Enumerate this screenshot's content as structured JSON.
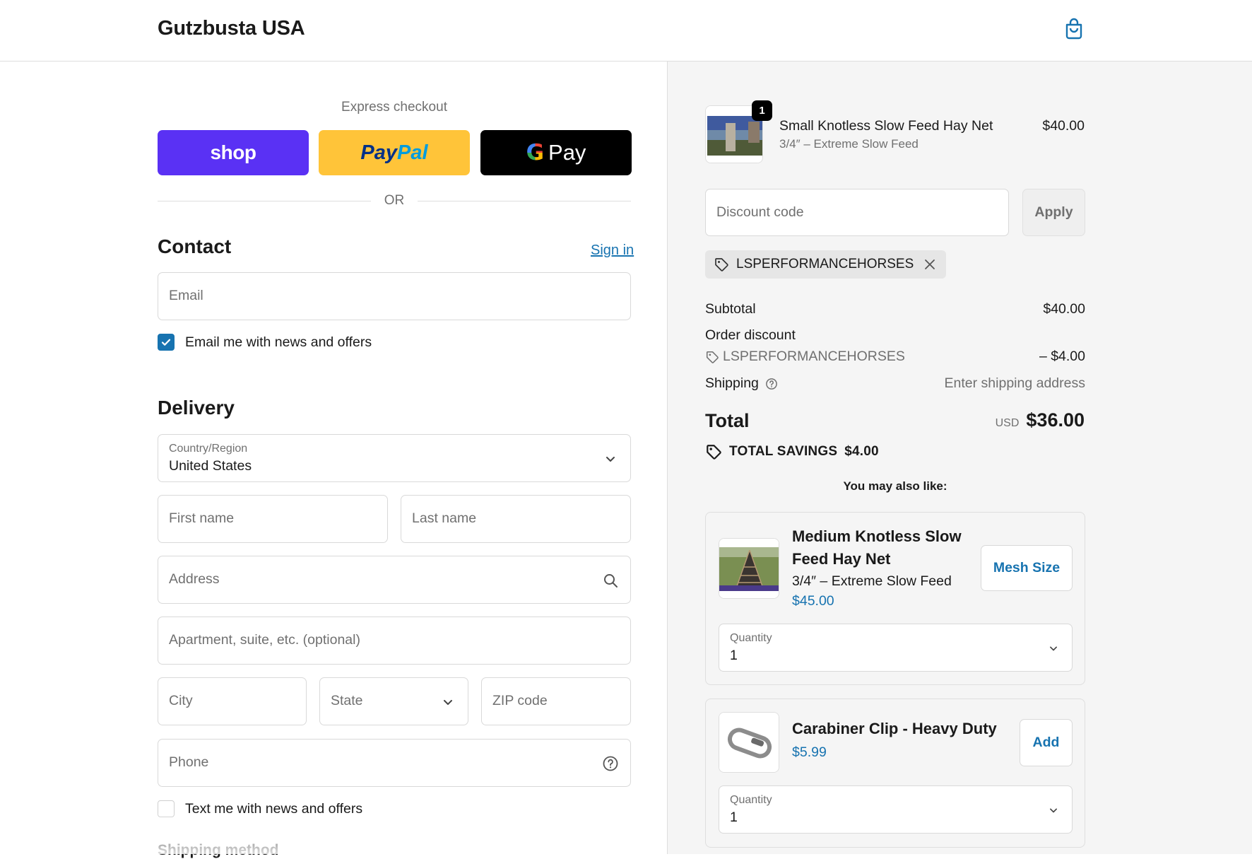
{
  "header": {
    "store_name": "Gutzbusta USA",
    "cart_icon": "shopping-bag-icon"
  },
  "express": {
    "label": "Express checkout",
    "buttons": [
      {
        "label": "shop",
        "color": "#5a31f4"
      },
      {
        "label_a": "Pay",
        "label_b": "Pal",
        "color": "#ffc439"
      },
      {
        "label_g": "G",
        "label": "Pay",
        "color": "#000000"
      }
    ],
    "or_text": "OR"
  },
  "contact": {
    "title": "Contact",
    "sign_in": "Sign in",
    "email_placeholder": "Email",
    "news_label": "Email me with news and offers",
    "news_checked": true
  },
  "delivery": {
    "title": "Delivery",
    "country_label": "Country/Region",
    "country_value": "United States",
    "first_name": "First name",
    "last_name": "Last name",
    "address": "Address",
    "apartment": "Apartment, suite, etc. (optional)",
    "city": "City",
    "state": "State",
    "zip": "ZIP code",
    "phone": "Phone",
    "text_label": "Text me with news and offers",
    "text_checked": false
  },
  "shipping_method_title": "Shipping method",
  "order": {
    "item": {
      "quantity": "1",
      "name": "Small Knotless Slow Feed Hay Net",
      "variant": "3/4″ – Extreme Slow Feed",
      "price": "$40.00"
    },
    "discount_placeholder": "Discount code",
    "apply_label": "Apply",
    "applied_code": "LSPERFORMANCEHORSES",
    "subtotal_label": "Subtotal",
    "subtotal_value": "$40.00",
    "order_discount_label": "Order discount",
    "discount_code": "LSPERFORMANCEHORSES",
    "discount_value": "– $4.00",
    "shipping_label": "Shipping",
    "shipping_value": "Enter shipping address",
    "total_label": "Total",
    "currency": "USD",
    "total_value": "$36.00",
    "savings_label": "TOTAL SAVINGS",
    "savings_value": "$4.00"
  },
  "recommendations": {
    "title": "You may also like:",
    "items": [
      {
        "name_line1": "Medium Knotless Slow",
        "name_line2": "Feed Hay Net",
        "variant": "3/4″ – Extreme Slow Feed",
        "price": "$45.00",
        "button": "Mesh Size",
        "quantity_label": "Quantity",
        "quantity": "1"
      },
      {
        "name_line1": "Carabiner Clip - Heavy Duty",
        "price": "$5.99",
        "button": "Add",
        "quantity_label": "Quantity",
        "quantity": "1"
      }
    ]
  },
  "colors": {
    "accent": "#1773b0",
    "summary_bg": "#f5f5f5"
  }
}
